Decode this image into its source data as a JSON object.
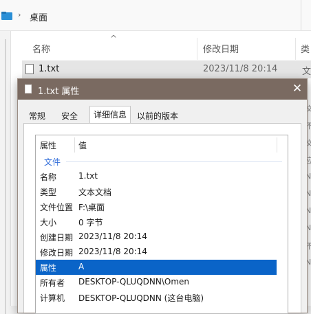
{
  "explorer": {
    "breadcrumb": "桌面",
    "columns": {
      "name": "名称",
      "modified": "修改日期",
      "type": "类"
    },
    "file": {
      "name": "1.txt",
      "modified": "2023/11/8 20:14",
      "type": "文"
    },
    "edge_chars": [
      "文",
      "不",
      "文",
      "应",
      "N",
      "N",
      "N",
      "N",
      "不",
      "N"
    ]
  },
  "dialog": {
    "title": "1.txt 属性",
    "close_symbol": "✕",
    "tabs": [
      "常规",
      "安全",
      "详细信息",
      "以前的版本"
    ],
    "active_tab": "详细信息",
    "table": {
      "header_property": "属性",
      "header_value": "值",
      "group_label": "文件",
      "rows": [
        {
          "name": "名称",
          "value": "1.txt"
        },
        {
          "name": "类型",
          "value": "文本文档"
        },
        {
          "name": "文件位置",
          "value": "F:\\桌面"
        },
        {
          "name": "大小",
          "value": "0 字节"
        },
        {
          "name": "创建日期",
          "value": "2023/11/8 20:14"
        },
        {
          "name": "修改日期",
          "value": "2023/11/8 20:14"
        },
        {
          "name": "属性",
          "value": "A"
        },
        {
          "name": "所有者",
          "value": "DESKTOP-QLUQDNN\\Omen"
        },
        {
          "name": "计算机",
          "value": "DESKTOP-QLUQDNN (这台电脑)"
        }
      ],
      "selected_row_index": 6
    }
  },
  "colors": {
    "titlebar": "#7a6a61",
    "selection": "#0a64c8",
    "group_label": "#2e6bd9"
  }
}
